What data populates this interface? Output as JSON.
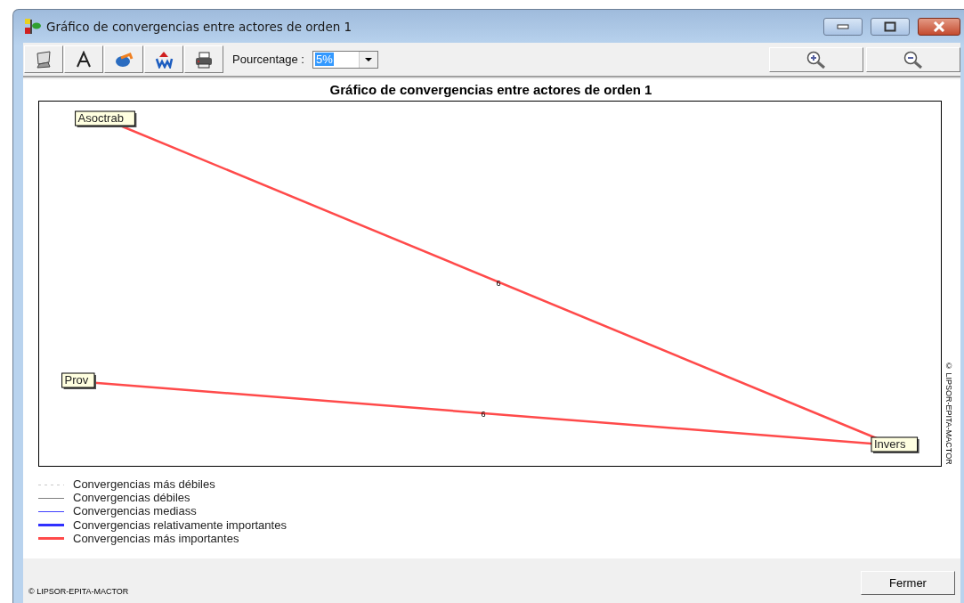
{
  "window": {
    "title": "Gráfico de convergencias entre actores de orden 1"
  },
  "toolbar": {
    "percent_label": "Pourcentage :",
    "percent_value": "5%"
  },
  "chart": {
    "title": "Gráfico de convergencias entre actores de orden 1",
    "credit": "© LIPSOR-EPITA-MACTOR",
    "nodes": [
      {
        "label": "Asoctrab"
      },
      {
        "label": "Prov"
      },
      {
        "label": "Invers"
      }
    ],
    "edges": [
      {
        "label": "6",
        "kind": "most_important"
      },
      {
        "label": "6",
        "kind": "most_important"
      }
    ]
  },
  "legend": [
    {
      "label": "Convergencias más débiles",
      "kind": "weakest",
      "color": "#c8c8c8"
    },
    {
      "label": "Convergencias débiles",
      "kind": "weak",
      "color": "#808080"
    },
    {
      "label": "Convergencias mediass",
      "kind": "medium",
      "color": "#4040ff"
    },
    {
      "label": "Convergencias relativamente importantes",
      "kind": "relatively_important",
      "color": "#3030ff"
    },
    {
      "label": "Convergencias más importantes",
      "kind": "most_important",
      "color": "#ff4a4a"
    }
  ],
  "footer": {
    "credit": "© LIPSOR-EPITA-MACTOR",
    "close_button": "Fermer"
  }
}
